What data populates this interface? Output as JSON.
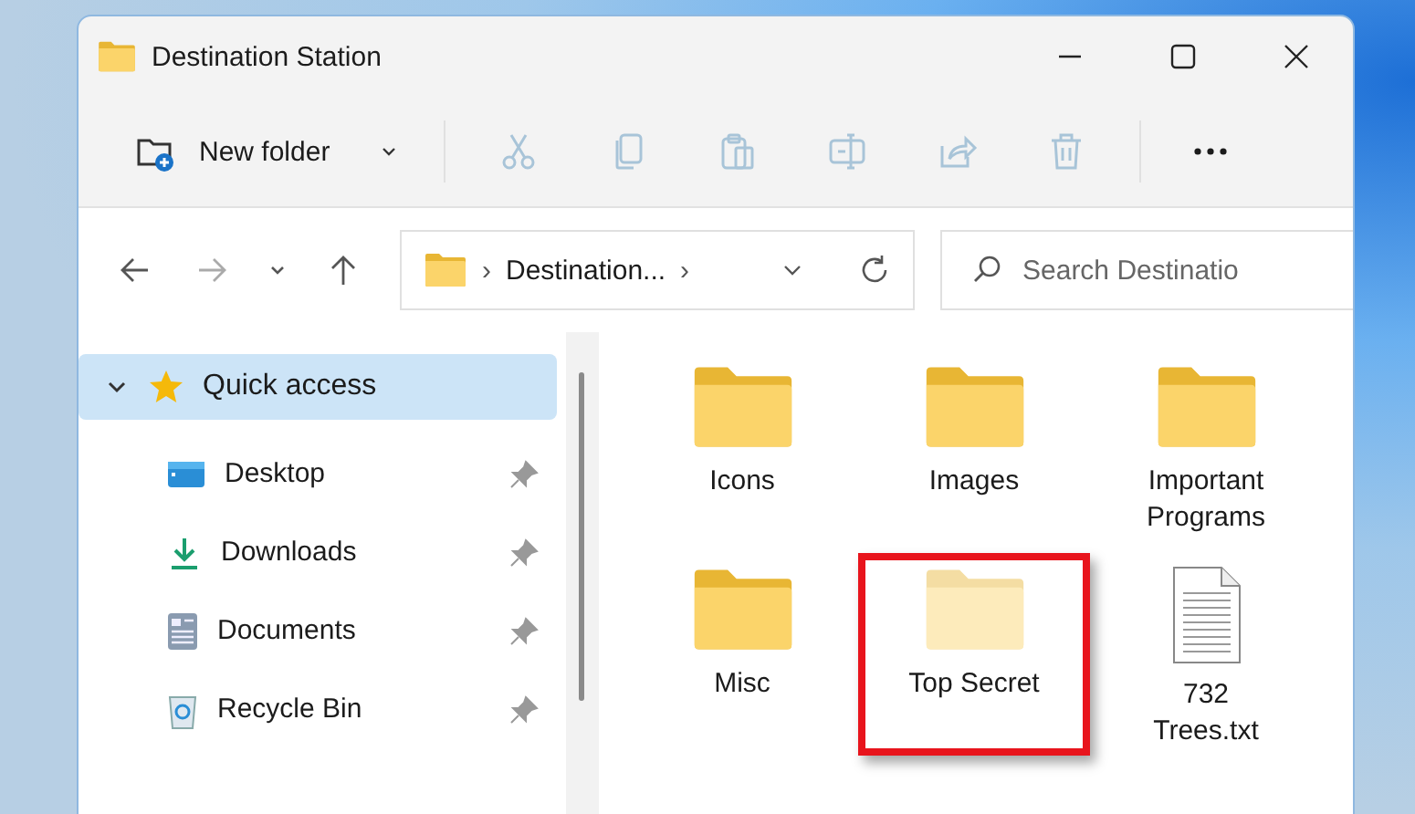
{
  "window": {
    "title": "Destination Station"
  },
  "toolbar": [
    {
      "kind": "new-folder",
      "label": "New folder",
      "disabled": false
    },
    {
      "kind": "cut",
      "disabled": true
    },
    {
      "kind": "copy",
      "disabled": true
    },
    {
      "kind": "paste",
      "disabled": true
    },
    {
      "kind": "rename",
      "disabled": true
    },
    {
      "kind": "share",
      "disabled": true
    },
    {
      "kind": "delete",
      "disabled": true
    },
    {
      "kind": "more",
      "disabled": false
    }
  ],
  "navigation": {
    "forward_disabled": true,
    "breadcrumbs": [
      {
        "kind": "separator",
        "text": "›"
      },
      {
        "kind": "crumb",
        "text": "Destination..."
      },
      {
        "kind": "separator",
        "text": "›"
      }
    ],
    "search": {
      "placeholder": "Search Destinatio"
    }
  },
  "sidebar": {
    "items": [
      {
        "label": "Quick access",
        "kind": "star",
        "selected": true,
        "expanded": true,
        "children": [
          {
            "label": "Desktop",
            "kind": "desktop",
            "pinned": true
          },
          {
            "label": "Downloads",
            "kind": "downloads",
            "pinned": true
          },
          {
            "label": "Documents",
            "kind": "documents",
            "pinned": true
          },
          {
            "label": "Recycle Bin",
            "kind": "recycle",
            "pinned": true
          }
        ]
      }
    ]
  },
  "files": [
    {
      "name": "Icons",
      "kind": "folder",
      "hidden": false,
      "highlighted": false
    },
    {
      "name": "Images",
      "kind": "folder",
      "hidden": false,
      "highlighted": false
    },
    {
      "name": "Important Programs",
      "kind": "folder",
      "hidden": false,
      "highlighted": false
    },
    {
      "name": "Misc",
      "kind": "folder",
      "hidden": false,
      "highlighted": false
    },
    {
      "name": "Top Secret",
      "kind": "folder",
      "hidden": true,
      "highlighted": true
    },
    {
      "name": "732 Trees.txt",
      "kind": "text",
      "hidden": false,
      "highlighted": false
    }
  ]
}
